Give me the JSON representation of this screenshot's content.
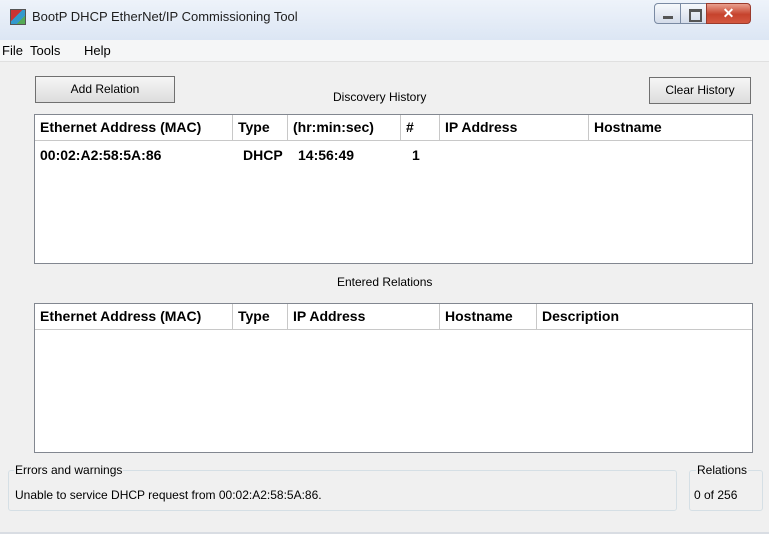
{
  "window": {
    "title": "BootP DHCP EtherNet/IP Commissioning Tool"
  },
  "menu": [
    "File",
    "Tools",
    "Help"
  ],
  "toolbar": {
    "add_relation": "Add Relation",
    "clear_history": "Clear History"
  },
  "discovery": {
    "label": "Discovery History",
    "columns": [
      "Ethernet Address (MAC)",
      "Type",
      "(hr:min:sec)",
      "#",
      "IP Address",
      "Hostname"
    ],
    "rows": [
      [
        "00:02:A2:58:5A:86",
        "DHCP",
        "14:56:49",
        "1",
        "",
        ""
      ]
    ]
  },
  "relations": {
    "label": "Entered Relations",
    "columns": [
      "Ethernet Address (MAC)",
      "Type",
      "IP Address",
      "Hostname",
      "Description"
    ],
    "rows": []
  },
  "errors": {
    "title": "Errors and warnings",
    "message": "Unable to service DHCP request from 00:02:A2:58:5A:86."
  },
  "relations_count": {
    "title": "Relations",
    "value": "0 of 256"
  }
}
